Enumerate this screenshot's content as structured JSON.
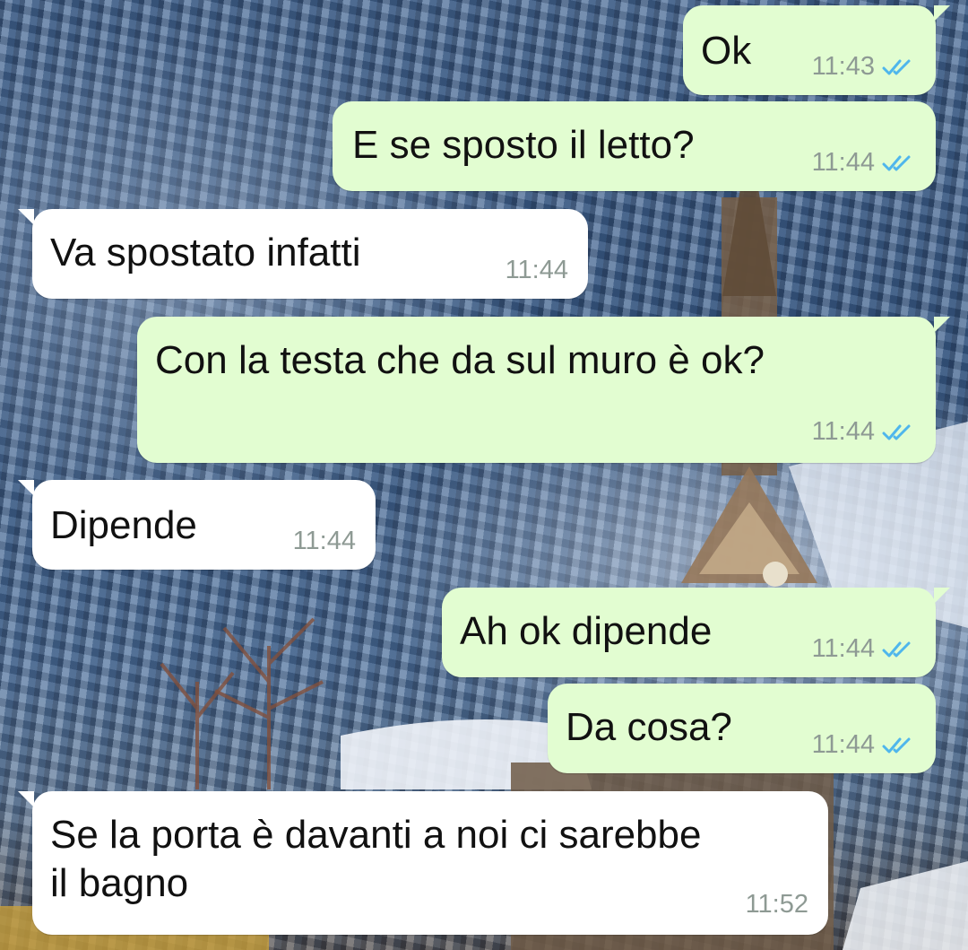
{
  "colors": {
    "outgoing_bubble": "#e2fdd1",
    "incoming_bubble": "#ffffff",
    "read_ticks": "#4fb6ec",
    "timestamp": "#8e9a94"
  },
  "messages": [
    {
      "direction": "outgoing",
      "text": "Ok",
      "time": "11:43",
      "status": "read-double-check-icon"
    },
    {
      "direction": "outgoing",
      "text": "E se sposto il letto?",
      "time": "11:44",
      "status": "read-double-check-icon"
    },
    {
      "direction": "incoming",
      "text": "Va spostato infatti",
      "time": "11:44"
    },
    {
      "direction": "outgoing",
      "text": "Con la testa che da sul muro è ok?",
      "time": "11:44",
      "status": "read-double-check-icon"
    },
    {
      "direction": "incoming",
      "text": "Dipende",
      "time": "11:44"
    },
    {
      "direction": "outgoing",
      "text": "Ah ok dipende",
      "time": "11:44",
      "status": "read-double-check-icon"
    },
    {
      "direction": "outgoing",
      "text": "Da cosa?",
      "time": "11:44",
      "status": "read-double-check-icon"
    },
    {
      "direction": "incoming",
      "text": "Se la porta è davanti a noi ci sarebbe\nil bagno",
      "time": "11:52"
    }
  ]
}
